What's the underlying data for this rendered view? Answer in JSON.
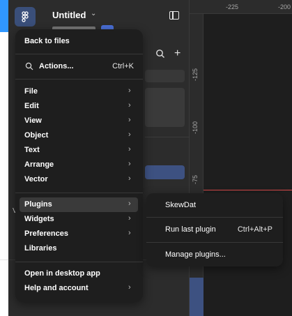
{
  "header": {
    "file_name": "Untitled"
  },
  "ruler": {
    "top_ticks": [
      "-225",
      "-200"
    ],
    "left_ticks": [
      "-125",
      "-100",
      "-75"
    ]
  },
  "left_panel": {
    "partial_letter": "V"
  },
  "main_menu": {
    "back_to_files": "Back to files",
    "actions_label": "Actions...",
    "actions_shortcut": "Ctrl+K",
    "items_group1": [
      {
        "label": "File"
      },
      {
        "label": "Edit"
      },
      {
        "label": "View"
      },
      {
        "label": "Object"
      },
      {
        "label": "Text"
      },
      {
        "label": "Arrange"
      },
      {
        "label": "Vector"
      }
    ],
    "items_group2": [
      {
        "label": "Plugins"
      },
      {
        "label": "Widgets"
      },
      {
        "label": "Preferences"
      },
      {
        "label": "Libraries"
      }
    ],
    "items_group3": [
      {
        "label": "Open in desktop app"
      },
      {
        "label": "Help and account"
      }
    ]
  },
  "plugins_menu": {
    "items": [
      {
        "label": "SkewDat",
        "shortcut": ""
      },
      {
        "label": "Run last plugin",
        "shortcut": "Ctrl+Alt+P"
      },
      {
        "label": "Manage plugins...",
        "shortcut": ""
      }
    ]
  },
  "colors": {
    "menu_bg": "#1e1e1e",
    "panel_bg": "#2c2c2c",
    "hover_bg": "#3a3a3a",
    "accent": "#3d5181"
  },
  "icons": {
    "main_menu": "figma-logo-icon",
    "chevron": "chevron-right-icon",
    "search": "search-icon"
  }
}
